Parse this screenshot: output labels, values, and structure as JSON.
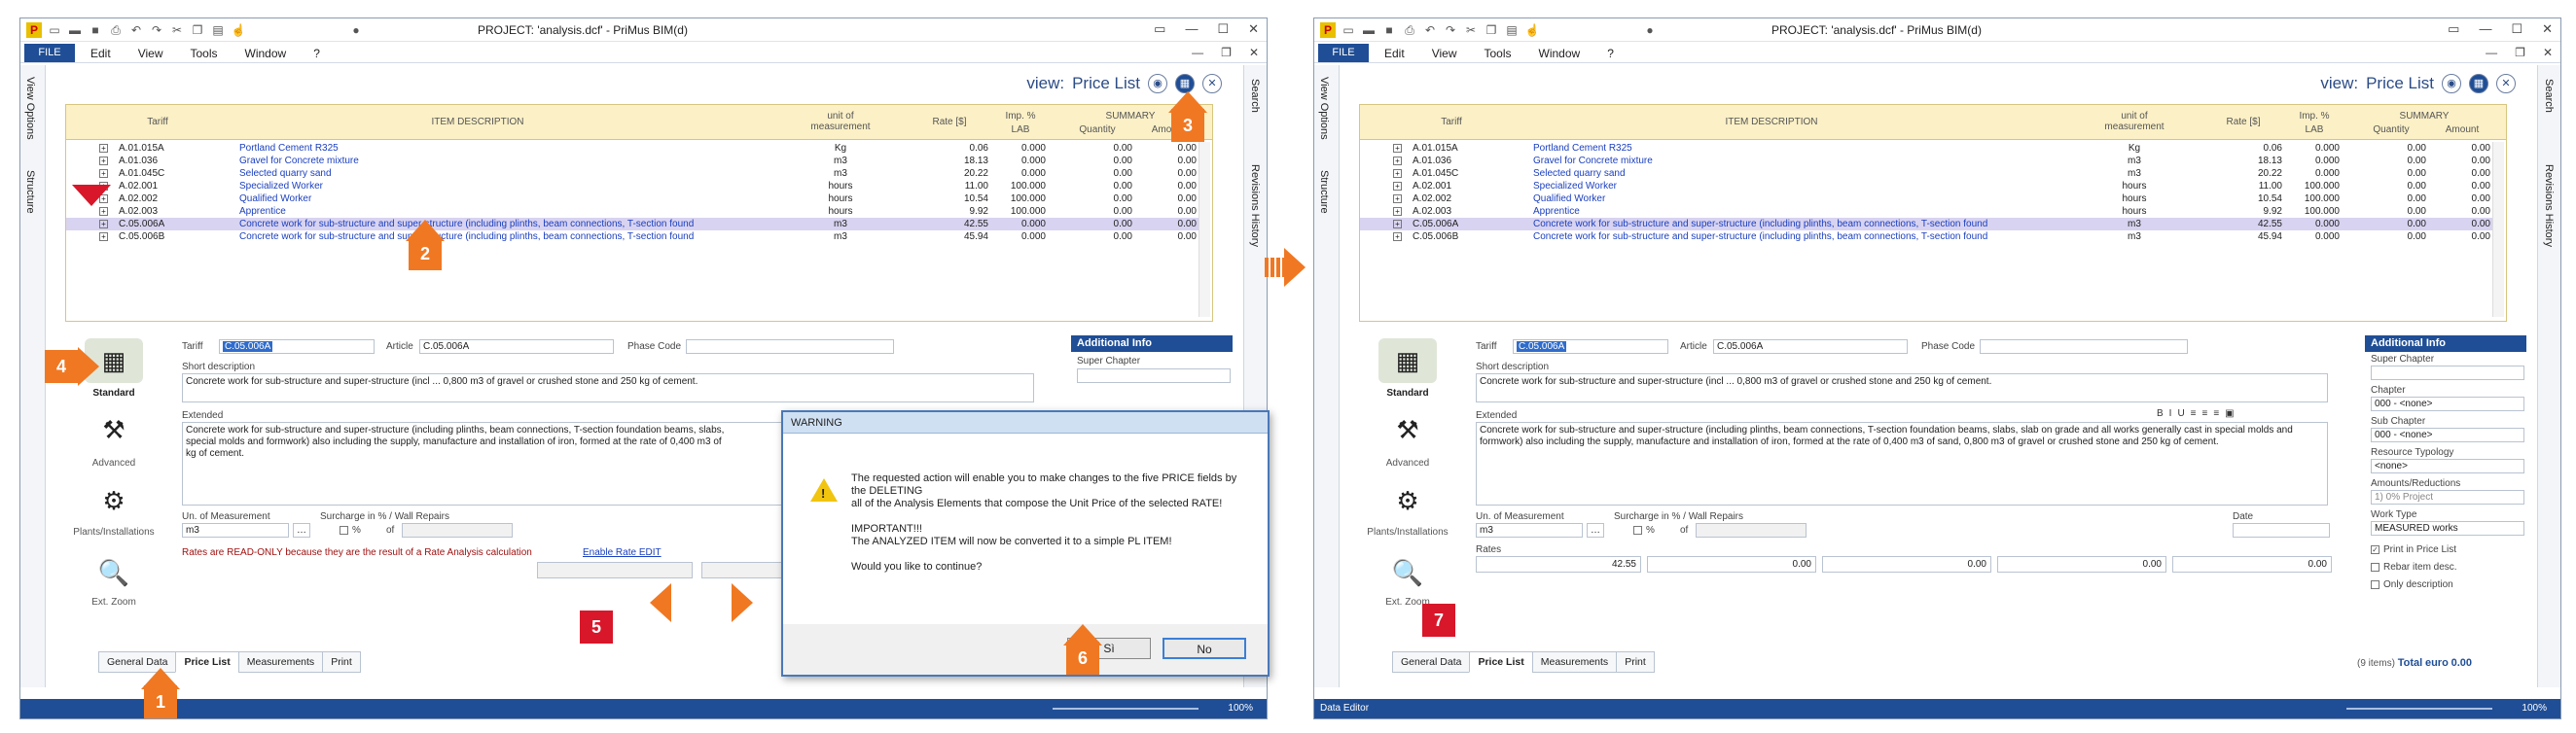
{
  "window": {
    "title": "PROJECT: 'analysis.dcf' - PriMus   BIM(d)",
    "menu": [
      "FILE",
      "Edit",
      "View",
      "Tools",
      "Window",
      "?"
    ]
  },
  "left_tabs": [
    "View Options",
    "Structure"
  ],
  "right_tabs": [
    "Search",
    "Revisions History"
  ],
  "view": {
    "prefix": "view:",
    "name": "Price List"
  },
  "grid": {
    "headers": {
      "tariff": "Tariff",
      "description": "ITEM DESCRIPTION",
      "unit": "unit of measurement",
      "rate": "Rate [$]",
      "imp": "Imp. %",
      "lab": "LAB",
      "summary": "SUMMARY",
      "quantity": "Quantity",
      "amount": "Amount"
    },
    "rows": [
      {
        "code": "A.01.015A",
        "desc": "Portland Cement R325",
        "unit": "Kg",
        "rate": "0.06",
        "imp": "0.000",
        "qty": "0.00",
        "amt": "0.00"
      },
      {
        "code": "A.01.036",
        "desc": "Gravel for Concrete mixture",
        "unit": "m3",
        "rate": "18.13",
        "imp": "0.000",
        "qty": "0.00",
        "amt": "0.00"
      },
      {
        "code": "A.01.045C",
        "desc": "Selected quarry sand",
        "unit": "m3",
        "rate": "20.22",
        "imp": "0.000",
        "qty": "0.00",
        "amt": "0.00"
      },
      {
        "code": "A.02.001",
        "desc": "Specialized Worker",
        "unit": "hours",
        "rate": "11.00",
        "imp": "100.000",
        "qty": "0.00",
        "amt": "0.00"
      },
      {
        "code": "A.02.002",
        "desc": "Qualified Worker",
        "unit": "hours",
        "rate": "10.54",
        "imp": "100.000",
        "qty": "0.00",
        "amt": "0.00"
      },
      {
        "code": "A.02.003",
        "desc": "Apprentice",
        "unit": "hours",
        "rate": "9.92",
        "imp": "100.000",
        "qty": "0.00",
        "amt": "0.00"
      },
      {
        "code": "C.05.006A",
        "desc": "Concrete work for sub-structure and super-structure (including plinths, beam connections, T-section found",
        "unit": "m3",
        "rate": "42.55",
        "imp": "0.000",
        "qty": "0.00",
        "amt": "0.00"
      },
      {
        "code": "C.05.006B",
        "desc": "Concrete work for sub-structure and super-structure (including plinths, beam connections, T-section found",
        "unit": "m3",
        "rate": "45.94",
        "imp": "0.000",
        "qty": "0.00",
        "amt": "0.00"
      }
    ]
  },
  "form": {
    "tariff_label": "Tariff",
    "tariff_value": "C.05.006A",
    "article_label": "Article",
    "article_value": "C.05.006A",
    "phase_label": "Phase Code",
    "short_label": "Short description",
    "short_value": "Concrete work for sub-structure and super-structure (incl ...  0,800 m3 of gravel or crushed stone and 250 kg of cement.",
    "extended_label": "Extended",
    "extended_value_1": "Concrete work for sub-structure and super-structure (including plinths, beam connections, T-section foundation beams, slabs,",
    "extended_value_2": "Concrete work for sub-structure and super-structure (including plinths, beam connections, T-section foundation beams, slabs, slab on grade and all works generally cast in special molds and formwork) also including the supply, manufacture and installation of iron, formed at the rate of 0,400 m3 of sand, 0,800 m3 of gravel or crushed stone and 250 kg of cement.",
    "extended_line_2": "special molds and formwork) also including the supply, manufacture and installation of iron, formed at the rate of 0,400 m3 of",
    "extended_line_3": "kg of cement.",
    "uom_label": "Un. of Measurement",
    "uom_value": "m3",
    "surcharge_label": "Surcharge in % / Wall Repairs",
    "surcharge_of": "of",
    "surcharge_pct": "%",
    "readonly_note": "Rates are READ-ONLY because they are the result of a Rate Analysis calculation",
    "enable_link": "Enable Rate EDIT",
    "date_label": "Date",
    "rates_label": "Rates",
    "rate_values": [
      "42.55",
      "0.00",
      "0.00",
      "0.00",
      "0.00"
    ]
  },
  "side_icons": [
    "Standard",
    "Advanced",
    "Plants/Installations",
    "Ext. Zoom"
  ],
  "addinfo": {
    "title": "Additional Info",
    "super_chapter": "Super Chapter",
    "chapter": "Chapter",
    "chapter_value": "000 - <none>",
    "sub_chapter": "Sub Chapter",
    "sub_chapter_value": "000 - <none>",
    "resource_typology": "Resource Typology",
    "resource_value": "<none>",
    "amounts_reductions": "Amounts/Reductions",
    "amounts_value": "1) 0% Project",
    "work_type": "Work Type",
    "work_type_value": "MEASURED works",
    "opt_print": "Print in Price List",
    "opt_rebar": "Rebar item desc.",
    "opt_only": "Only description"
  },
  "bottom_tabs": [
    "General Data",
    "Price List",
    "Measurements",
    "Print"
  ],
  "footer": {
    "items": "(9 items)",
    "total_label": "Total",
    "currency": "euro",
    "total_value": "0.00"
  },
  "status": {
    "right_zoom": "100%",
    "left_text_2": "Data Editor"
  },
  "dialog": {
    "title": "WARNING",
    "line1": "The requested action will enable you to make changes to the five PRICE fields by the DELETING",
    "line2": "all of the Analysis Elements that compose the Unit Price of the selected RATE!",
    "line3": "IMPORTANT!!!",
    "line4": "The ANALYZED ITEM will now be converted it to a simple PL ITEM!",
    "line5": "Would you like to continue?",
    "yes": "Sì",
    "no": "No"
  },
  "badges": [
    "1",
    "2",
    "3",
    "4",
    "5",
    "6",
    "7"
  ],
  "colors": {
    "accent": "#1f4e96",
    "orange": "#f07822",
    "red": "#d8172a",
    "header": "#fbf0c6"
  }
}
